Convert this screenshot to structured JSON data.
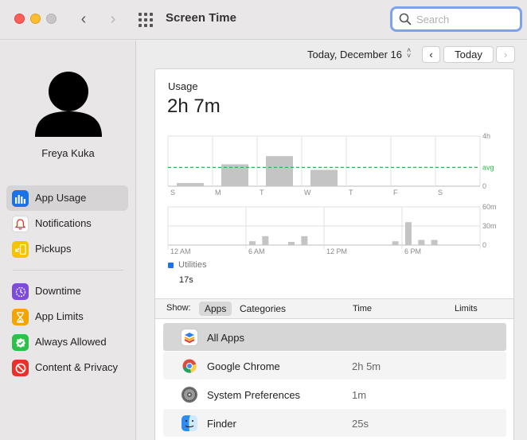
{
  "window": {
    "title": "Screen Time"
  },
  "colors": {
    "accent": "#1a73e8",
    "avg_line": "#2db84a",
    "bar": "#c4c4c4",
    "search_focus": "#7ea3ea"
  },
  "search": {
    "placeholder": "Search",
    "value": ""
  },
  "sidebar": {
    "user_name": "Freya Kuka",
    "items": [
      {
        "label": "App Usage",
        "icon": "bar-chart-icon",
        "color": "#1a73e8",
        "active": true
      },
      {
        "label": "Notifications",
        "icon": "bell-icon",
        "color": "#ffffff",
        "active": false
      },
      {
        "label": "Pickups",
        "icon": "pickup-icon",
        "color": "#f5c400",
        "active": false
      },
      {
        "label": "Downtime",
        "icon": "downtime-icon",
        "color": "#7d4cdb",
        "active": false
      },
      {
        "label": "App Limits",
        "icon": "hourglass-icon",
        "color": "#f4a300",
        "active": false
      },
      {
        "label": "Always Allowed",
        "icon": "checkmark-shield-icon",
        "color": "#2ec04b",
        "active": false
      },
      {
        "label": "Content & Privacy",
        "icon": "no-entry-icon",
        "color": "#e8312b",
        "active": false
      }
    ]
  },
  "date_bar": {
    "label": "Today, December 16",
    "today_button": "Today"
  },
  "usage": {
    "label": "Usage",
    "total": "2h 7m"
  },
  "chart_data": [
    {
      "type": "bar",
      "categories": [
        "S",
        "M",
        "T",
        "W",
        "T",
        "F",
        "S"
      ],
      "values": [
        0.25,
        1.75,
        2.4,
        1.3,
        0,
        0,
        0
      ],
      "unit": "hours",
      "ylim": [
        0,
        4
      ],
      "yticks": [
        "4h",
        "avg",
        "0"
      ],
      "average": 1.5,
      "average_label": "avg"
    },
    {
      "type": "bar",
      "categories": [
        "12 AM",
        "6 AM",
        "12 PM",
        "6 PM"
      ],
      "x_hours": [
        6,
        7,
        9,
        10,
        17,
        18,
        19,
        20
      ],
      "values": [
        6,
        14,
        5,
        14,
        6,
        36,
        8,
        8
      ],
      "unit": "minutes",
      "ylim": [
        0,
        60
      ],
      "yticks": [
        "60m",
        "30m",
        "0"
      ],
      "legend": [
        {
          "name": "Utilities",
          "value": "17s",
          "color": "#1a73e8"
        }
      ]
    }
  ],
  "list": {
    "show_label": "Show:",
    "segments": [
      "Apps",
      "Categories"
    ],
    "col_time": "Time",
    "col_limits": "Limits",
    "rows": [
      {
        "name": "All Apps",
        "time": "",
        "icon": "all-apps-icon"
      },
      {
        "name": "Google Chrome",
        "time": "2h 5m",
        "icon": "chrome-icon"
      },
      {
        "name": "System Preferences",
        "time": "1m",
        "icon": "system-preferences-icon"
      },
      {
        "name": "Finder",
        "time": "25s",
        "icon": "finder-icon"
      }
    ]
  }
}
